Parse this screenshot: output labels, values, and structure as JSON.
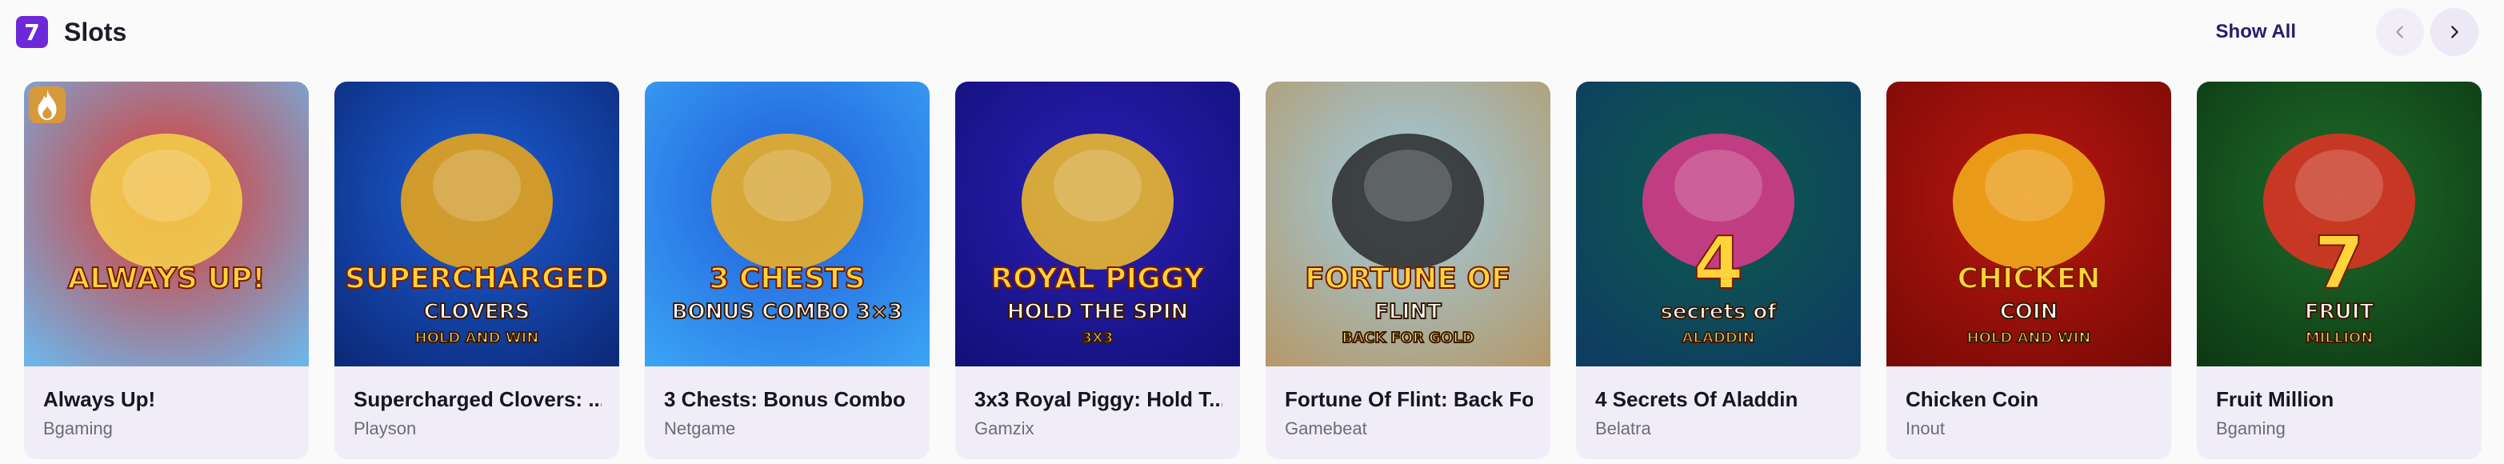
{
  "header": {
    "icon_glyph": "7",
    "title": "Slots",
    "show_all_label": "Show All",
    "prev_icon": "chevron-left-icon",
    "next_icon": "chevron-right-icon"
  },
  "games": [
    {
      "name": "Always Up!",
      "provider": "Bgaming",
      "art_text": "ALWAYS UP!",
      "hot": true,
      "colors": [
        "#e1352a",
        "#6fb4e8",
        "#f6d34a"
      ]
    },
    {
      "name": "Supercharged Clovers: ...",
      "provider": "Playson",
      "art_text": "SUPERCHARGED",
      "art_text2": "CLOVERS",
      "art_text3": "HOLD AND WIN",
      "colors": [
        "#1c5fd6",
        "#0c2a7a",
        "#f2a814"
      ]
    },
    {
      "name": "3 Chests: Bonus Combo",
      "provider": "Netgame",
      "art_text": "3 CHESTS",
      "art_text2": "BONUS COMBO 3×3",
      "colors": [
        "#1e5bd8",
        "#3aa2f5",
        "#f7b21c"
      ]
    },
    {
      "name": "3x3 Royal Piggy: Hold T...",
      "provider": "Gamzix",
      "art_text": "ROYAL PIGGY",
      "art_text2": "HOLD THE SPIN",
      "art_text3": "3X3",
      "colors": [
        "#2b1fb5",
        "#13107a",
        "#f6c22a"
      ]
    },
    {
      "name": "Fortune Of Flint: Back Fo...",
      "provider": "Gamebeat",
      "art_text": "FORTUNE OF",
      "art_text2": "FLINT",
      "art_text3": "BACK FOR GOLD",
      "colors": [
        "#9dcde6",
        "#b49a6c",
        "#2a2a2a"
      ]
    },
    {
      "name": "4 Secrets Of Aladdin",
      "provider": "Belatra",
      "art_text": "4",
      "art_text2": "secrets of",
      "art_text3": "ALADDIN",
      "colors": [
        "#0c5c4c",
        "#0f3b62",
        "#e23a8c"
      ]
    },
    {
      "name": "Chicken Coin",
      "provider": "Inout",
      "art_text": "CHICKEN",
      "art_text2": "COIN",
      "art_text3": "HOLD AND WIN",
      "colors": [
        "#b9170f",
        "#7a0a06",
        "#f5b31b"
      ]
    },
    {
      "name": "Fruit Million",
      "provider": "Bgaming",
      "art_text": "7",
      "art_text2": "FRUIT",
      "art_text3": "MILLION",
      "colors": [
        "#1e6b2a",
        "#0d3a14",
        "#e63124"
      ]
    }
  ]
}
